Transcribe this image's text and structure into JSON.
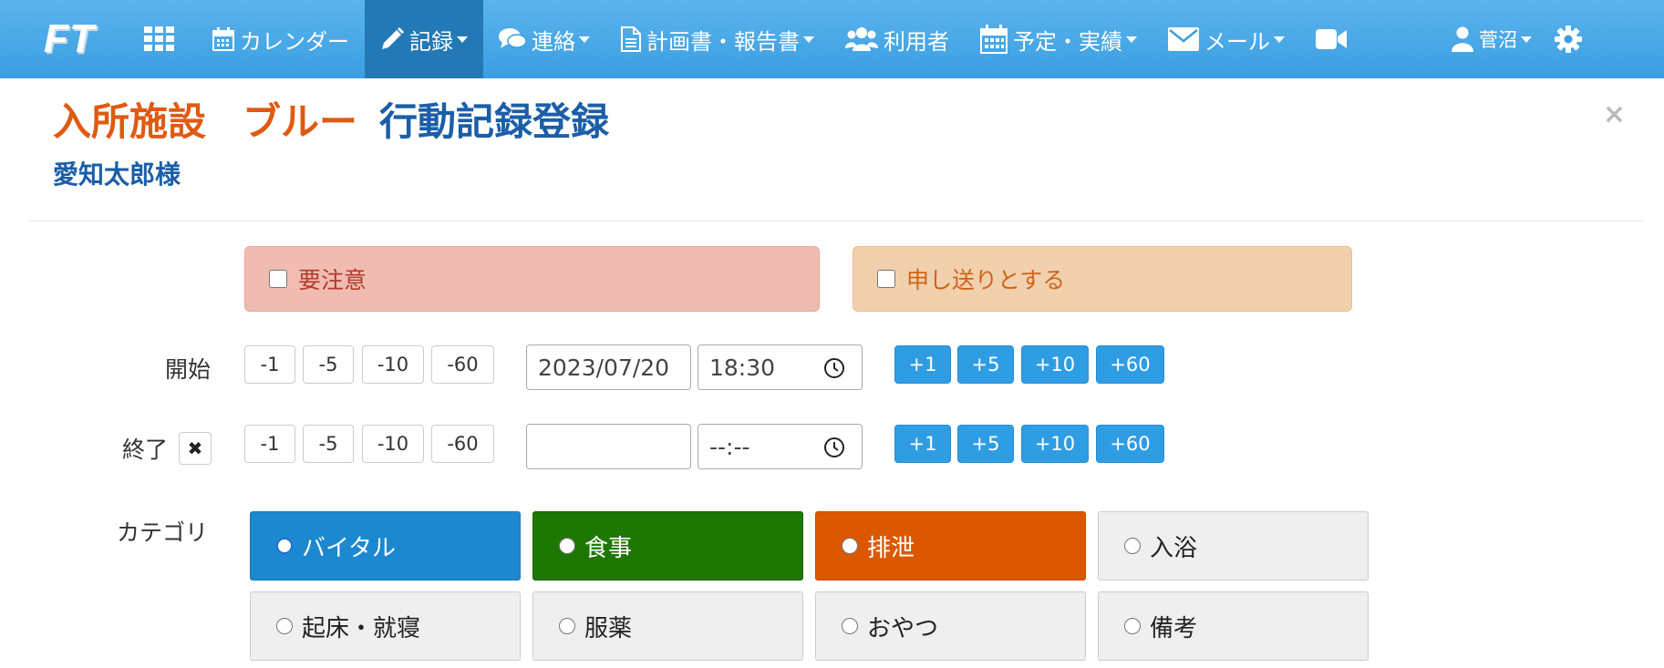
{
  "nav": {
    "logo_text": "FT",
    "items": [
      {
        "label": "カレンダー",
        "icon": "calendar-icon",
        "caret": false
      },
      {
        "label": "記録",
        "icon": "pencil-icon",
        "caret": true
      },
      {
        "label": "連絡",
        "icon": "comments-icon",
        "caret": true
      },
      {
        "label": "計画書・報告書",
        "icon": "document-icon",
        "caret": true
      },
      {
        "label": "利用者",
        "icon": "users-icon",
        "caret": false
      },
      {
        "label": "予定・実績",
        "icon": "calendar-icon",
        "caret": true
      },
      {
        "label": "メール",
        "icon": "envelope-icon",
        "caret": true
      }
    ],
    "user_label": "菅沼"
  },
  "header": {
    "facility": "入所施設",
    "unit": "ブルー",
    "page_title": "行動記録登録",
    "resident": "愛知太郎様",
    "close": "×"
  },
  "flags": {
    "caution_label": "要注意",
    "handover_label": "申し送りとする"
  },
  "time": {
    "start_label": "開始",
    "end_label": "終了",
    "clear": "✖",
    "minus": [
      "-1",
      "-5",
      "-10",
      "-60"
    ],
    "plus": [
      "+1",
      "+5",
      "+10",
      "+60"
    ],
    "start_date": "2023/07/20",
    "start_time": "18:30",
    "end_date": "",
    "end_time": "--:--"
  },
  "category": {
    "label": "カテゴリ",
    "options": [
      "バイタル",
      "食事",
      "排泄",
      "入浴",
      "起床・就寝",
      "服薬",
      "おやつ",
      "備考"
    ],
    "selected": "バイタル"
  },
  "colors": {
    "navbar": "#3a9ee2",
    "active_nav": "#2379b5",
    "vital": "#1b88cf",
    "meal": "#1e7702",
    "excretion": "#dc5800",
    "plus_button": "#2f9de4"
  }
}
